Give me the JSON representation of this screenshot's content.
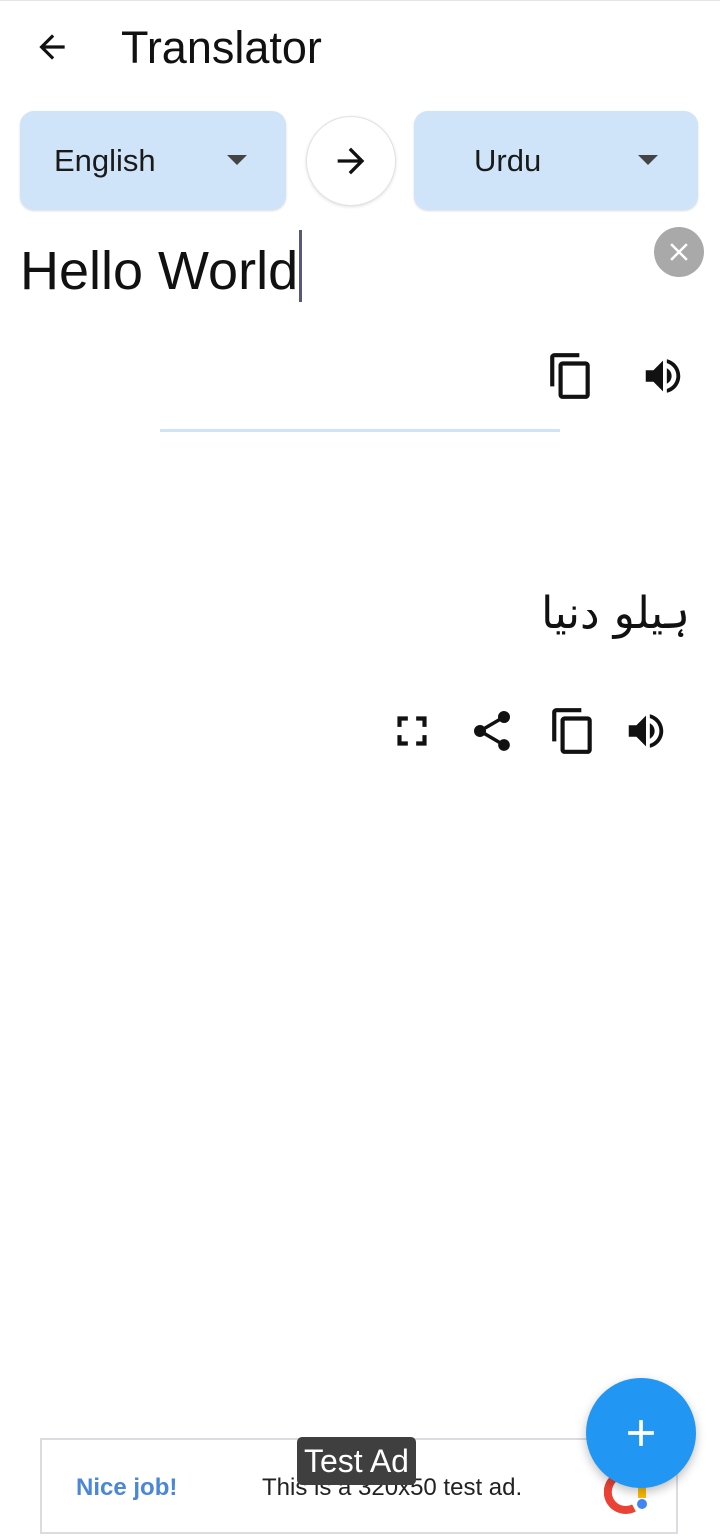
{
  "appbar": {
    "title": "Translator",
    "back_icon": "arrow-back-icon"
  },
  "languages": {
    "source": "English",
    "target": "Urdu",
    "swap_icon": "arrow-forward-icon"
  },
  "source": {
    "text": "Hello World",
    "clear_icon": "close-icon",
    "copy_icon": "copy-icon",
    "speak_icon": "volume-up-icon"
  },
  "translation": {
    "text": "ہیلو دنیا",
    "fullscreen_icon": "fullscreen-icon",
    "share_icon": "share-icon",
    "copy_icon": "copy-icon",
    "speak_icon": "volume-up-icon"
  },
  "ad": {
    "headline": "Nice job!",
    "body": "This is a 320x50 test ad.",
    "tag": "Test Ad"
  },
  "fab": {
    "icon": "add-icon"
  },
  "colors": {
    "accent": "#2196f3",
    "chip": "#cfe4f8",
    "ad_headline": "#4a87d6"
  }
}
